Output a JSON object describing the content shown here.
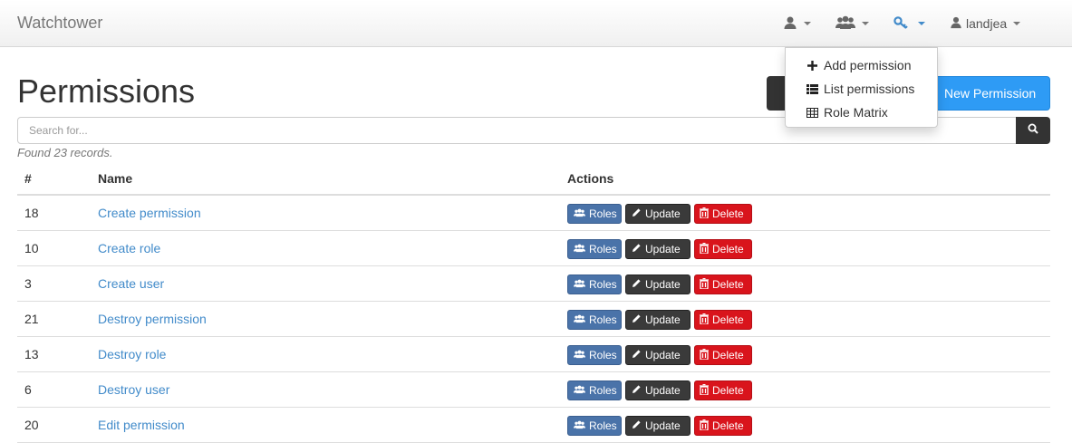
{
  "navbar": {
    "brand": "Watchtower",
    "user_label": "landjea",
    "menu_icons": [
      "user-icon",
      "users-icon",
      "key-icon"
    ]
  },
  "dropdown": {
    "items": [
      {
        "label": "Add permission",
        "icon": "plus-icon"
      },
      {
        "label": "List permissions",
        "icon": "list-icon"
      },
      {
        "label": "Role Matrix",
        "icon": "table-icon"
      }
    ]
  },
  "page": {
    "title": "Permissions",
    "new_button": "New Permission"
  },
  "search": {
    "placeholder": "Search for...",
    "value": ""
  },
  "records_text": "Found 23 records.",
  "table": {
    "headers": [
      "#",
      "Name",
      "Actions"
    ],
    "action_labels": {
      "roles": "Roles",
      "update": "Update",
      "delete": "Delete"
    },
    "rows": [
      {
        "id": "18",
        "name": "Create permission"
      },
      {
        "id": "10",
        "name": "Create role"
      },
      {
        "id": "3",
        "name": "Create user"
      },
      {
        "id": "21",
        "name": "Destroy permission"
      },
      {
        "id": "13",
        "name": "Destroy role"
      },
      {
        "id": "6",
        "name": "Destroy user"
      },
      {
        "id": "20",
        "name": "Edit permission"
      }
    ]
  },
  "colors": {
    "link": "#428bca",
    "primary": "#2e9bf5",
    "roles": "#4a73a9",
    "update": "#3a3a3a",
    "delete": "#d9141c"
  }
}
